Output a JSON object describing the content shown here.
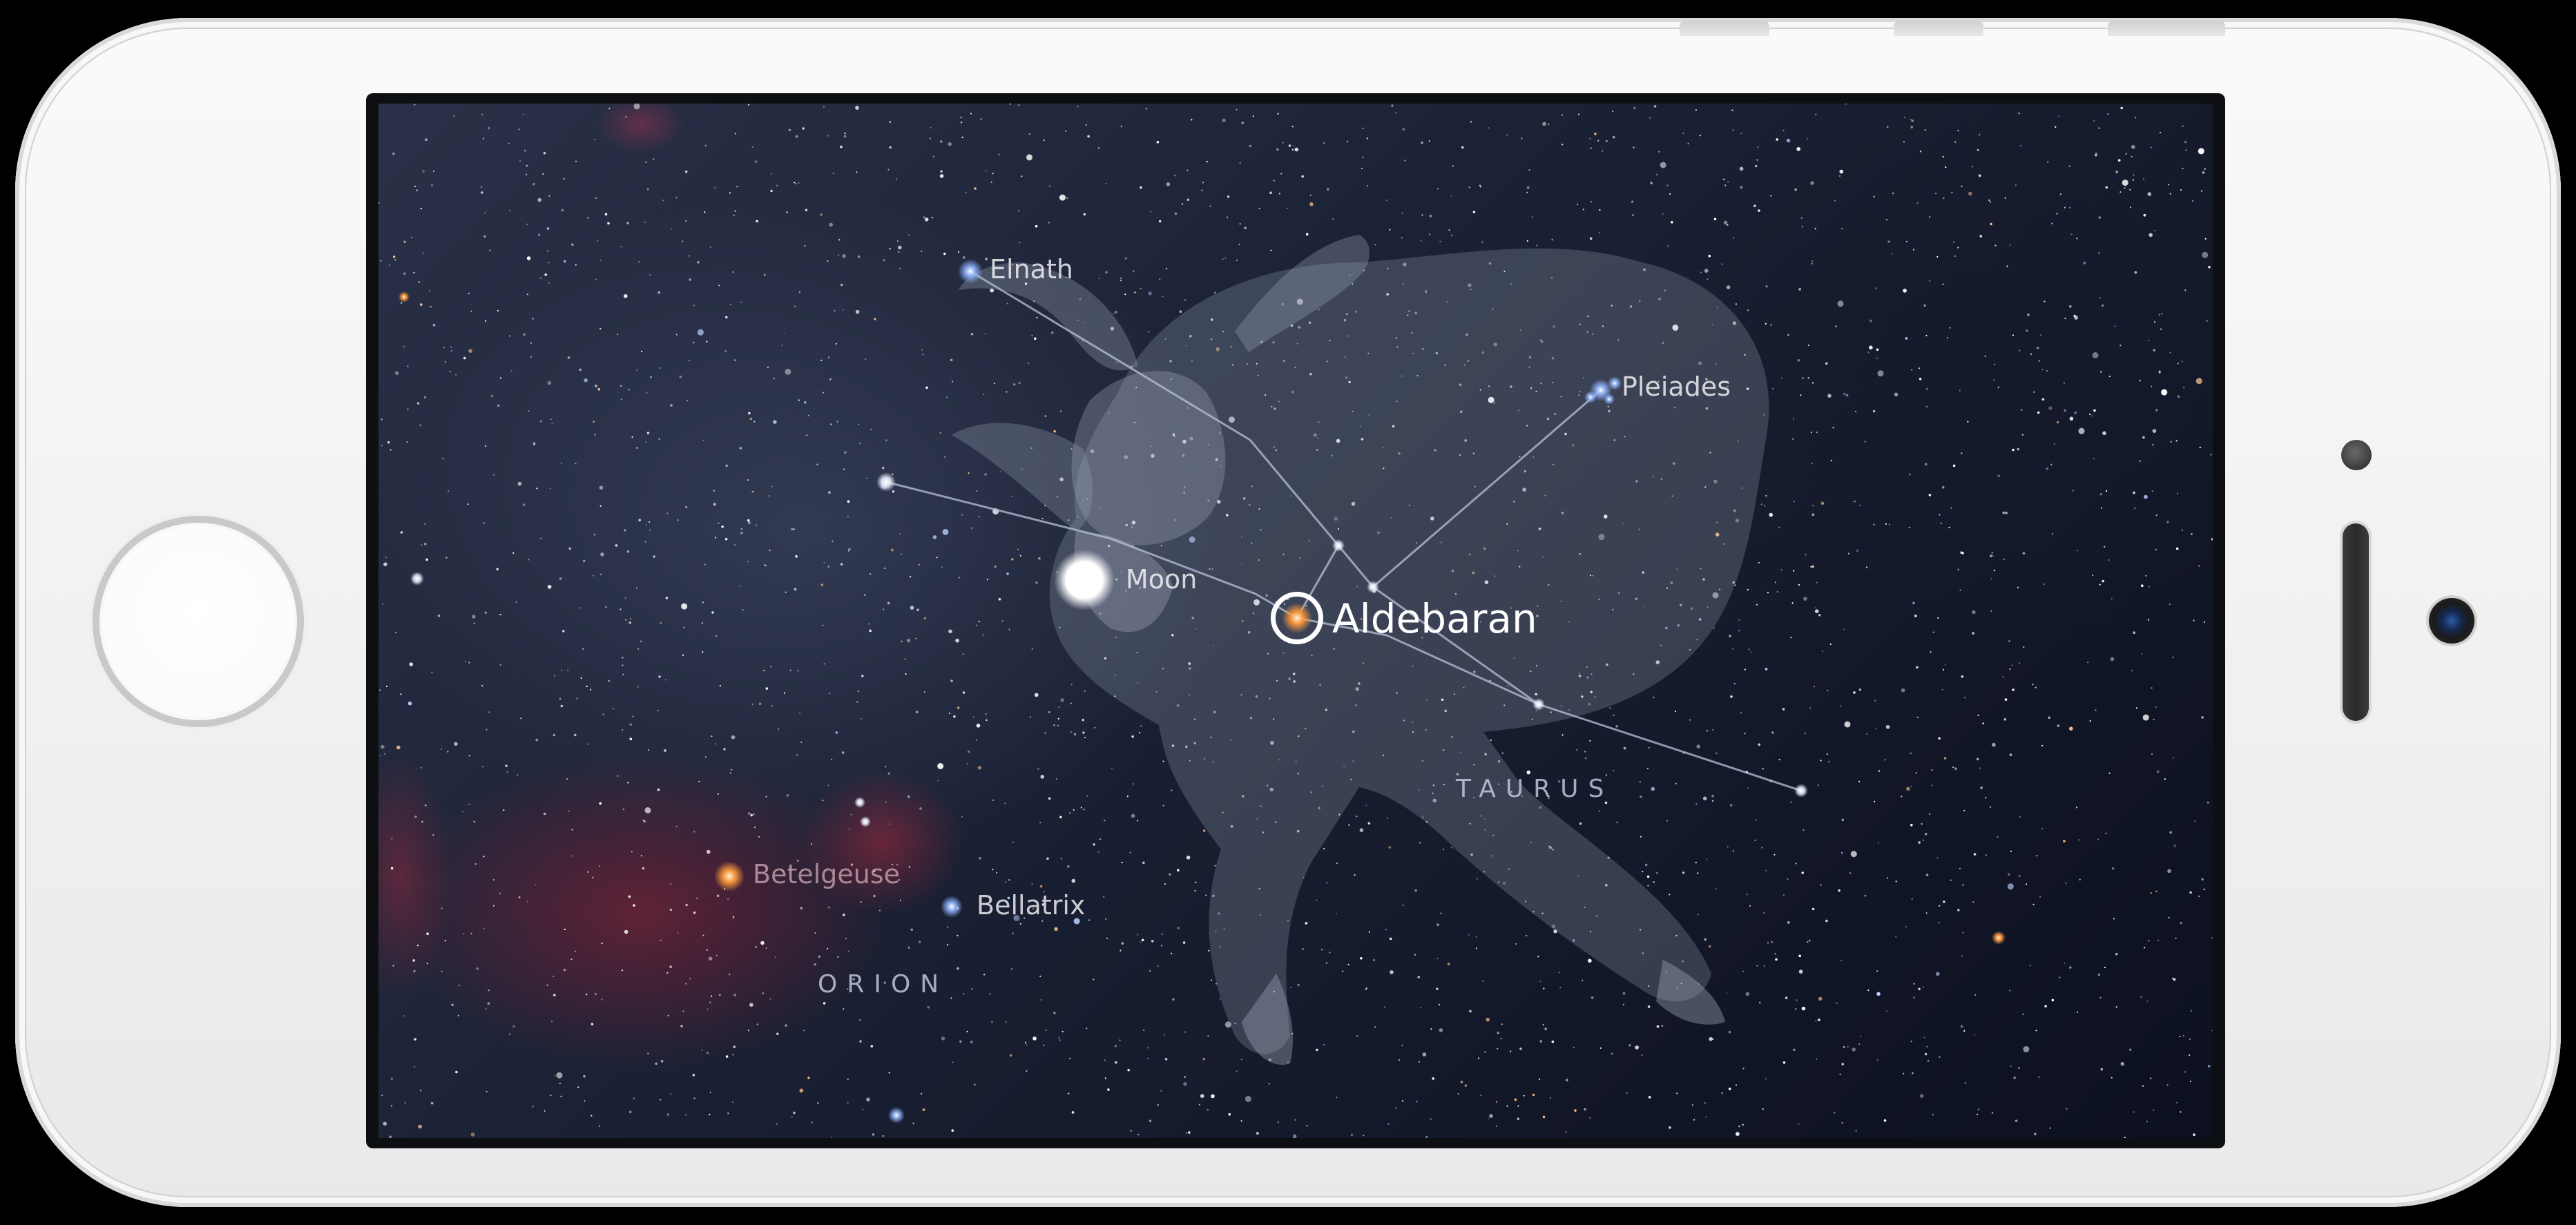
{
  "sky_labels": {
    "elnath": "Elnath",
    "pleiades": "Pleiades",
    "moon": "Moon",
    "aldebaran": "Aldebaran",
    "taurus": "TAURUS",
    "betelgeuse": "Betelgeuse",
    "bellatrix": "Bellatrix",
    "orion": "ORION"
  },
  "selected_object": "Aldebaran",
  "colors": {
    "sky": "#1a2034",
    "nebula": "#8c1f35",
    "constellation_line": "#b8c2d8",
    "phone_body": "#f4f4f4",
    "selection_ring": "#ffffff"
  },
  "icons": {
    "home_button": "home-button",
    "front_camera": "camera-icon",
    "moon": "moon-icon",
    "selection": "target-reticle-icon"
  }
}
